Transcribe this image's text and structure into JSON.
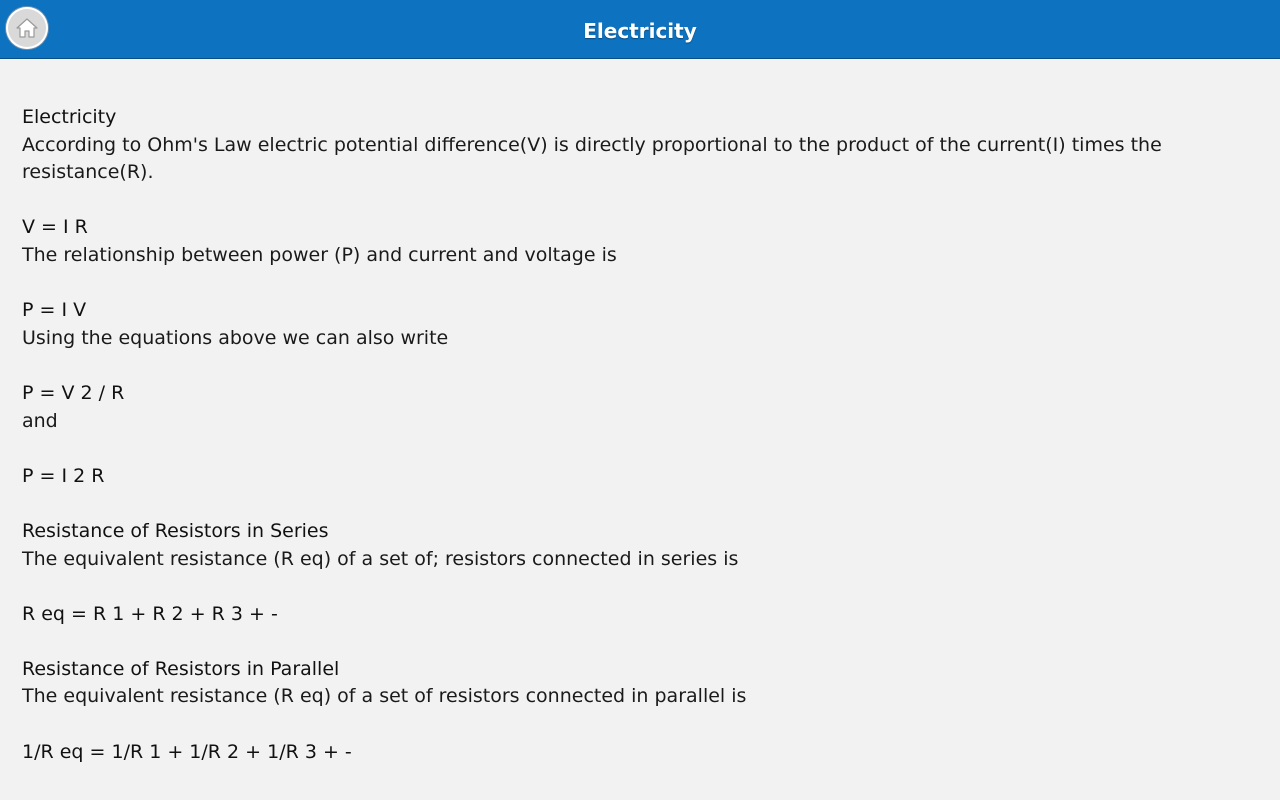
{
  "header": {
    "title": "Electricity",
    "home_icon": "home-icon",
    "bar_color": "#0d72bf"
  },
  "content": {
    "heading_main": "Electricity",
    "ohm_text": "According to Ohm's Law electric potential difference(V) is directly proportional to the product of the current(I) times the resistance(R).",
    "formula_vir": "V = I R",
    "power_text": "The relationship between power (P) and current and voltage is",
    "formula_piv": "P = I V",
    "using_text": "Using the equations above we can also write",
    "formula_pv2r": "P = V 2 / R",
    "and_text": "and",
    "formula_pi2r": "P = I 2 R",
    "heading_series": "Resistance of Resistors in Series",
    "series_text": "The equivalent resistance (R eq) of a set of; resistors connected in series is",
    "formula_series": "R eq = R 1 + R 2 + R 3 + -",
    "heading_parallel": "Resistance of Resistors in Parallel",
    "parallel_text": "The equivalent resistance (R eq) of a set of resistors connected in parallel is",
    "formula_parallel": "1/R eq = 1/R 1 + 1/R 2 + 1/R 3 + -"
  }
}
